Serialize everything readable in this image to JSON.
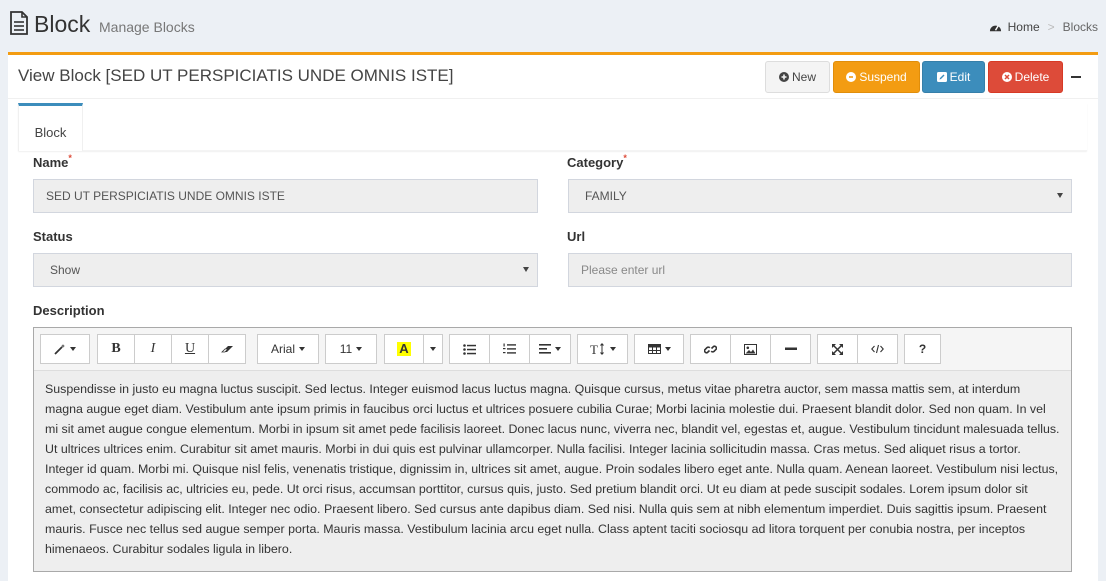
{
  "header": {
    "title": "Block",
    "subtitle": "Manage Blocks",
    "breadcrumb": {
      "home": "Home",
      "current": "Blocks"
    }
  },
  "box": {
    "title": "View Block [SED UT PERSPICIATIS UNDE OMNIS ISTE]",
    "buttons": {
      "new": "New",
      "suspend": "Suspend",
      "edit": "Edit",
      "delete": "Delete"
    }
  },
  "tabs": [
    {
      "label": "Block"
    }
  ],
  "form": {
    "name": {
      "label": "Name",
      "required_mark": "*",
      "value": "SED UT PERSPICIATIS UNDE OMNIS ISTE"
    },
    "category": {
      "label": "Category",
      "required_mark": "*",
      "value": "FAMILY"
    },
    "status": {
      "label": "Status",
      "value": "Show"
    },
    "url": {
      "label": "Url",
      "placeholder": "Please enter url"
    },
    "description": {
      "label": "Description",
      "toolbar": {
        "font_family": "Arial",
        "font_size": "11",
        "highlight_letter": "A",
        "bold": "B",
        "italic": "I",
        "underline": "U",
        "help": "?"
      },
      "content": "Suspendisse in justo eu magna luctus suscipit. Sed lectus. Integer euismod lacus luctus magna. Quisque cursus, metus vitae pharetra auctor, sem massa mattis sem, at interdum magna augue eget diam. Vestibulum ante ipsum primis in faucibus orci luctus et ultrices posuere cubilia Curae; Morbi lacinia molestie dui. Praesent blandit dolor. Sed non quam. In vel mi sit amet augue congue elementum. Morbi in ipsum sit amet pede facilisis laoreet. Donec lacus nunc, viverra nec, blandit vel, egestas et, augue. Vestibulum tincidunt malesuada tellus. Ut ultrices ultrices enim. Curabitur sit amet mauris. Morbi in dui quis est pulvinar ullamcorper. Nulla facilisi. Integer lacinia sollicitudin massa. Cras metus. Sed aliquet risus a tortor. Integer id quam. Morbi mi. Quisque nisl felis, venenatis tristique, dignissim in, ultrices sit amet, augue. Proin sodales libero eget ante. Nulla quam. Aenean laoreet. Vestibulum nisi lectus, commodo ac, facilisis ac, ultricies eu, pede. Ut orci risus, accumsan porttitor, cursus quis, justo. Sed pretium blandit orci. Ut eu diam at pede suscipit sodales. Lorem ipsum dolor sit amet, consectetur adipiscing elit. Integer nec odio. Praesent libero. Sed cursus ante dapibus diam. Sed nisi. Nulla quis sem at nibh elementum imperdiet. Duis sagittis ipsum. Praesent mauris. Fusce nec tellus sed augue semper porta. Mauris massa. Vestibulum lacinia arcu eget nulla. Class aptent taciti sociosqu ad litora torquent per conubia nostra, per inceptos himenaeos. Curabitur sodales ligula in libero."
    }
  },
  "colors": {
    "accent_orange": "#f39c12",
    "primary_blue": "#3c8dbc",
    "danger_red": "#dd4b39",
    "page_bg": "#ecf0f5"
  },
  "icons": {
    "page": "file-text-icon",
    "home": "dashboard-icon",
    "new": "plus-circle-icon",
    "suspend": "ban-circle-icon",
    "edit": "pencil-square-icon",
    "delete": "minus-circle-icon",
    "collapse": "minus-icon"
  }
}
